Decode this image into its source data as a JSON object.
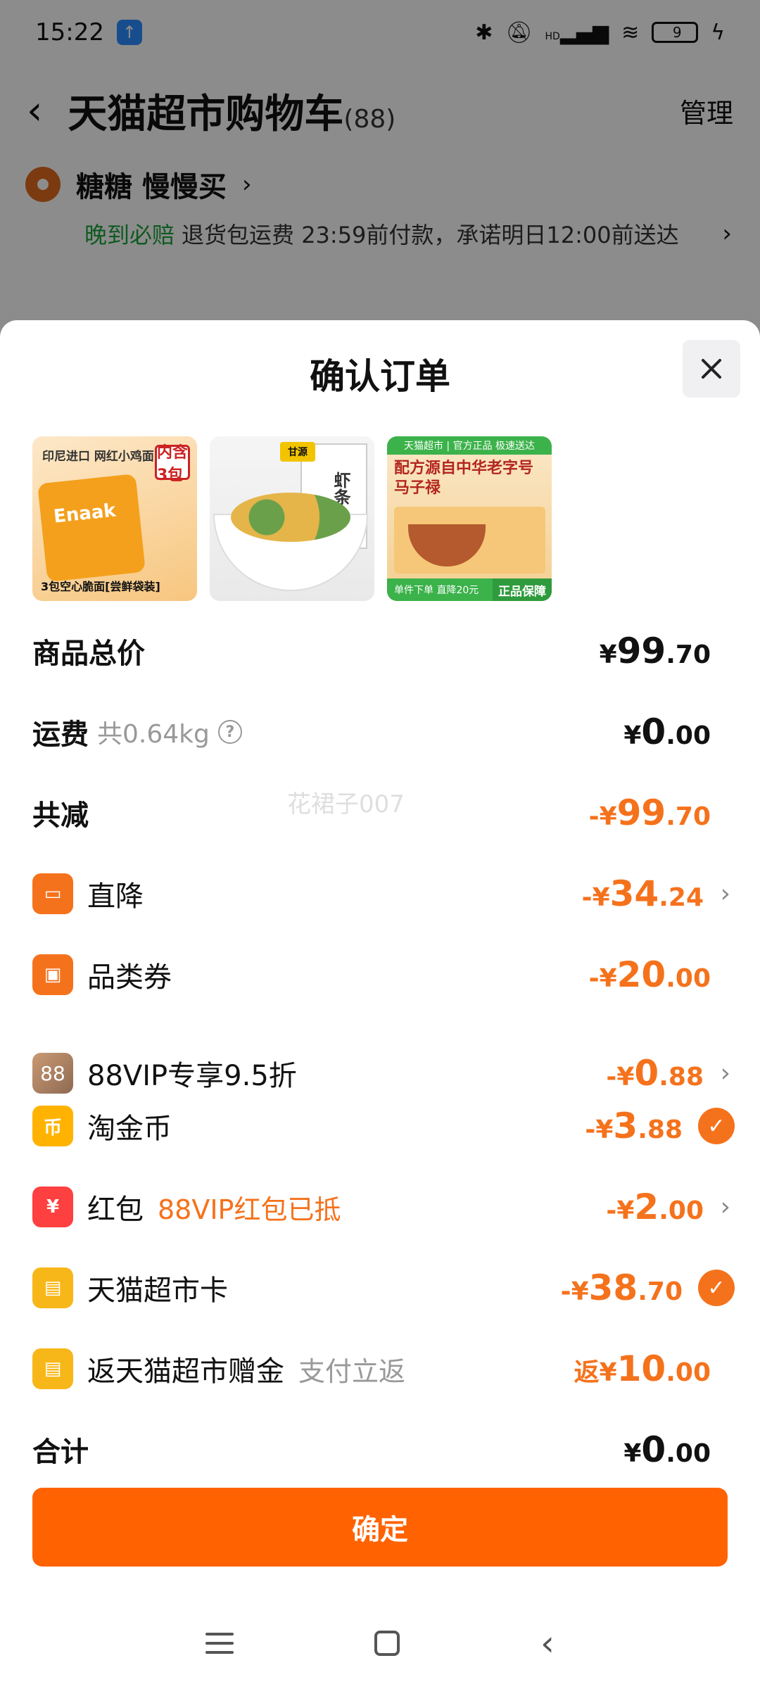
{
  "status_bar": {
    "time": "15:22",
    "battery": "9",
    "signal_text": "HD"
  },
  "cart_header": {
    "title": "天猫超市购物车",
    "count": "(88)",
    "manage": "管理"
  },
  "store": {
    "name": "糖糖 慢慢买",
    "delivery_promise": "晚到必赔",
    "delivery_text": "退货包运费 23:59前付款，承诺明日12:00前送达"
  },
  "sheet": {
    "title": "确认订单",
    "products": [
      {
        "top_label": "印尼进口 网红小鸡面",
        "badge": "内含3包",
        "brand": "Enaak",
        "bottom_label": "3包空心脆面[尝鲜袋装]"
      },
      {
        "brand": "甘源",
        "name": "虾条"
      },
      {
        "header": "天猫超市 | 官方正品 极速送达",
        "title": "配方源自中华老字号马子禄",
        "footer": "单件下单 直降20元",
        "guarantee": "正品保障"
      }
    ],
    "rows": {
      "subtotal": {
        "label": "商品总价",
        "currency": "¥",
        "integer": "99",
        "decimal": ".70"
      },
      "shipping": {
        "label": "运费",
        "weight": "共0.64kg",
        "currency": "¥",
        "integer": "0",
        "decimal": ".00"
      },
      "total_discount": {
        "label": "共减",
        "currency": "-¥",
        "integer": "99",
        "decimal": ".70"
      },
      "direct_cut": {
        "label": "直降",
        "currency": "-¥",
        "integer": "34",
        "decimal": ".24"
      },
      "category_coupon": {
        "label": "品类券",
        "currency": "-¥",
        "integer": "20",
        "decimal": ".00"
      },
      "vip_discount": {
        "label": "88VIP专享9.5折",
        "icon_text": "88",
        "currency": "-¥",
        "integer": "0",
        "decimal": ".88"
      },
      "tao_coin": {
        "label": "淘金币",
        "icon_text": "币",
        "currency": "-¥",
        "integer": "3",
        "decimal": ".88"
      },
      "red_packet": {
        "label": "红包",
        "note": "88VIP红包已抵",
        "currency": "-¥",
        "integer": "2",
        "decimal": ".00"
      },
      "tmall_card": {
        "label": "天猫超市卡",
        "currency": "-¥",
        "integer": "38",
        "decimal": ".70"
      },
      "rebate": {
        "label": "返天猫超市赠金",
        "note": "支付立返",
        "currency": "返¥",
        "integer": "10",
        "decimal": ".00"
      },
      "grand_total": {
        "label": "合计",
        "currency": "¥",
        "integer": "0",
        "decimal": ".00"
      }
    },
    "watermark": "花裙子007",
    "confirm_button": "确定"
  },
  "colors": {
    "accent": "#ff6200",
    "discount": "#f5721c",
    "green": "#1aa33b"
  },
  "icons": [
    "bluetooth-icon",
    "mute-icon",
    "signal-icon",
    "wifi-icon",
    "battery-icon",
    "back-arrow-icon",
    "location-icon",
    "close-icon",
    "help-icon",
    "check-icon"
  ]
}
